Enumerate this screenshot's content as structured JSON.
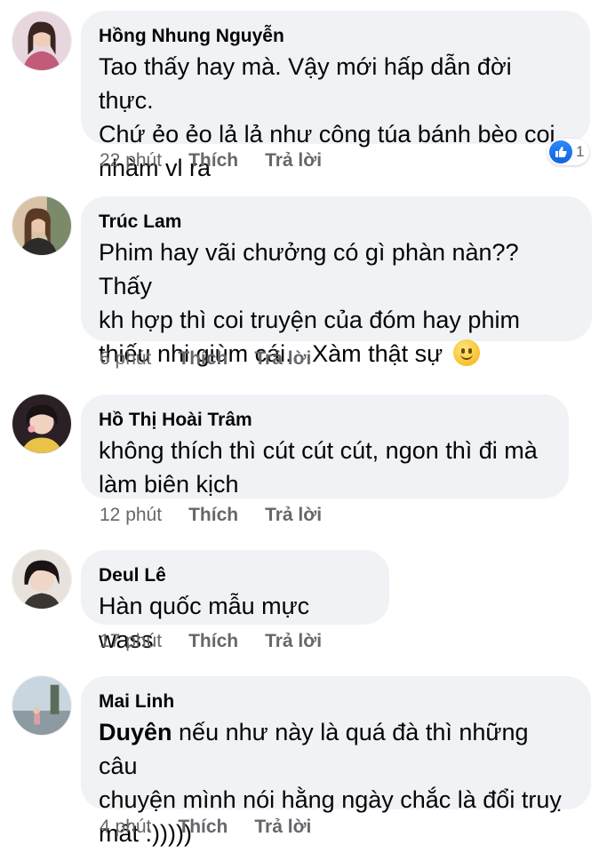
{
  "comments": [
    {
      "name": "Hồng Nhung Nguyễn",
      "lines": [
        "Tao thấy hay mà. Vậy mới hấp dẫn đời thực.",
        "Chứ ẻo ẻo lả lả như công túa bánh bèo coi",
        "nhàm vl ra"
      ],
      "time": "22 phút",
      "like": "Thích",
      "reply": "Trả lời",
      "reaction": {
        "icon": "like-icon",
        "count": "1"
      }
    },
    {
      "name": "Trúc Lam",
      "lines": [
        "Phim hay vãi chưởng có gì phàn nàn?? Thấy",
        "kh hợp thì coi truyện của đóm hay phim",
        "thiếu nhi giùm cái... Xàm thật sự"
      ],
      "emoji": "slightly-smiling-face-icon",
      "time": "6 phút",
      "like": "Thích",
      "reply": "Trả lời"
    },
    {
      "name": "Hồ Thị Hoài Trâm",
      "lines": [
        "không thích thì cút cút cút, ngon thì đi mà",
        "làm biên kịch"
      ],
      "time": "12 phút",
      "like": "Thích",
      "reply": "Trả lời"
    },
    {
      "name": "Deul Lê",
      "lines": [
        "Hàn quốc mẫu mực wass"
      ],
      "time": "17 phút",
      "like": "Thích",
      "reply": "Trả lời"
    },
    {
      "name": "Mai Linh",
      "mention": "Duyên",
      "lines": [
        " nếu như này là quá đà thì những câu",
        "chuyện mình nói hằng ngày chắc là đổi truỵ",
        "mất :)))))"
      ],
      "time": "4 phút",
      "like": "Thích",
      "reply": "Trả lời"
    }
  ],
  "colors": {
    "bubble": "#f0f2f5",
    "meta": "#65676b",
    "text": "#050505",
    "like_blue": "#1877f2"
  }
}
